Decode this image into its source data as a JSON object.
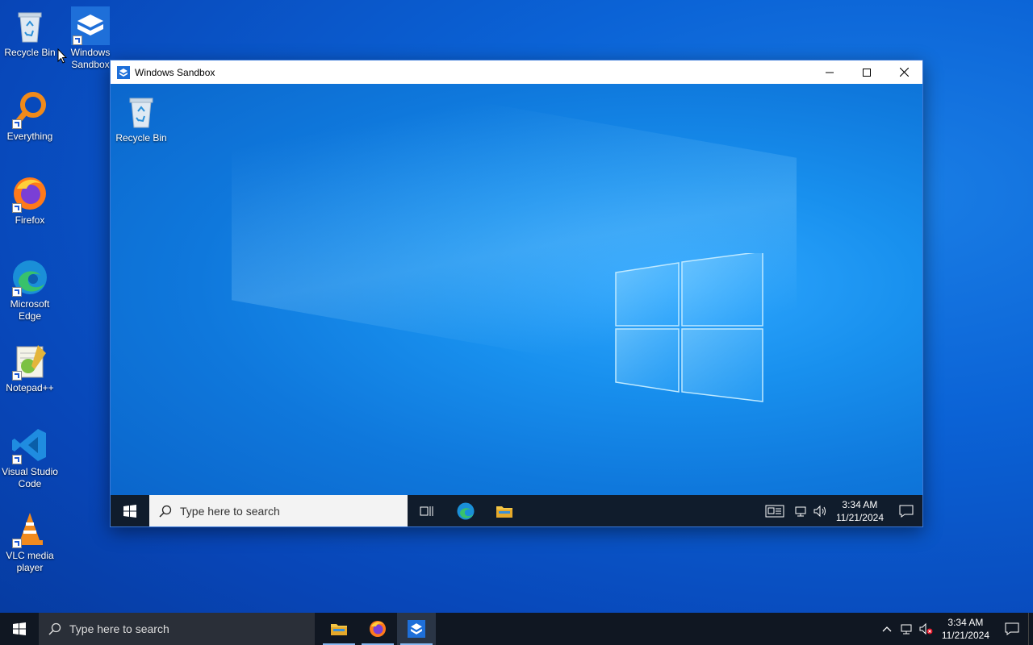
{
  "desktop": {
    "icons": [
      {
        "label": "Recycle Bin"
      },
      {
        "label": "Windows Sandbox"
      },
      {
        "label": "Everything"
      },
      {
        "label": "Firefox"
      },
      {
        "label": "Microsoft Edge"
      },
      {
        "label": "Notepad++"
      },
      {
        "label": "Visual Studio Code"
      },
      {
        "label": "VLC media player"
      }
    ]
  },
  "sandbox": {
    "title": "Windows Sandbox",
    "desktop_icon_label": "Recycle Bin",
    "search_placeholder": "Type here to search",
    "clock_time": "3:34 AM",
    "clock_date": "11/21/2024"
  },
  "taskbar": {
    "search_placeholder": "Type here to search",
    "clock_time": "3:34 AM",
    "clock_date": "11/21/2024"
  },
  "colors": {
    "accent": "#0a66d8",
    "taskbar": "#101722"
  }
}
